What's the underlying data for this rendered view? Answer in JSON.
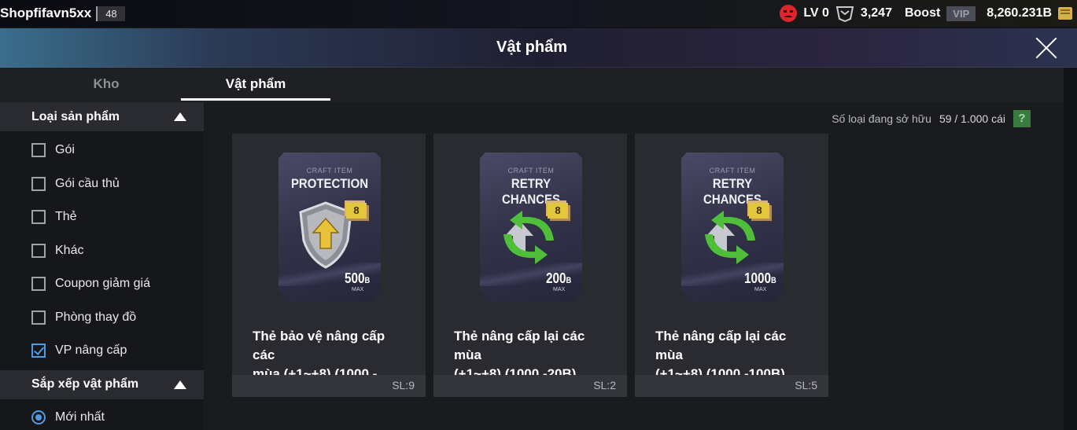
{
  "topbar": {
    "username": "Shopfifavn5xx",
    "level": "48",
    "rank_level": "LV 0",
    "points": "3,247",
    "boost_label": "Boost",
    "vip_label": "VIP",
    "balance": "8,260.231B",
    "icons": [
      "sad-face-icon",
      "rank-icon",
      "coin-icon"
    ]
  },
  "window": {
    "title": "Vật phẩm",
    "close_icon": "close-icon"
  },
  "tabs": [
    {
      "label": "Kho",
      "active": false
    },
    {
      "label": "Vật phẩm",
      "active": true
    }
  ],
  "sidebar": {
    "product_type": {
      "heading": "Loại sản phẩm",
      "items": [
        {
          "label": "Gói",
          "checked": false
        },
        {
          "label": "Gói cầu thủ",
          "checked": false
        },
        {
          "label": "Thẻ",
          "checked": false
        },
        {
          "label": "Khác",
          "checked": false
        },
        {
          "label": "Coupon giảm giá",
          "checked": false
        },
        {
          "label": "Phòng thay đồ",
          "checked": false
        },
        {
          "label": "VP nâng cấp",
          "checked": true
        }
      ]
    },
    "sort": {
      "heading": "Sắp xếp vật phẩm",
      "items": [
        {
          "label": "Mới nhất",
          "selected": true
        }
      ]
    }
  },
  "main": {
    "owned_label": "Số loại đang sở hữu",
    "owned_count": "59 / 1.000 cái",
    "help_label": "?",
    "items": [
      {
        "craft_label": "CRAFT ITEM",
        "craft_title": "PROTECTION",
        "level": "8",
        "price": "500",
        "price_unit": "B",
        "price_sub": "MAX",
        "name_line1": "Thẻ bảo vệ nâng cấp các",
        "name_line2": "mùa (+1~+8) (1000 -",
        "qty": "SL:9",
        "icon": "shield-upgrade-icon"
      },
      {
        "craft_label": "CRAFT ITEM",
        "craft_title": "RETRY CHANCES",
        "level": "8",
        "price": "200",
        "price_unit": "B",
        "price_sub": "MAX",
        "name_line1": "Thẻ nâng cấp lại các mùa",
        "name_line2": "(+1~+8) (1000 -20B)",
        "qty": "SL:2",
        "icon": "retry-arrows-icon"
      },
      {
        "craft_label": "CRAFT ITEM",
        "craft_title": "RETRY CHANCES",
        "level": "8",
        "price": "1000",
        "price_unit": "B",
        "price_sub": "MAX",
        "name_line1": "Thẻ nâng cấp lại các mùa",
        "name_line2": "(+1~+8) (1000 -100B)",
        "qty": "SL:5",
        "icon": "retry-arrows-icon"
      }
    ]
  },
  "colors": {
    "accent_blue": "#4f9be0",
    "help_green": "#3b7a3e",
    "badge_gold": "#e3c73d"
  }
}
